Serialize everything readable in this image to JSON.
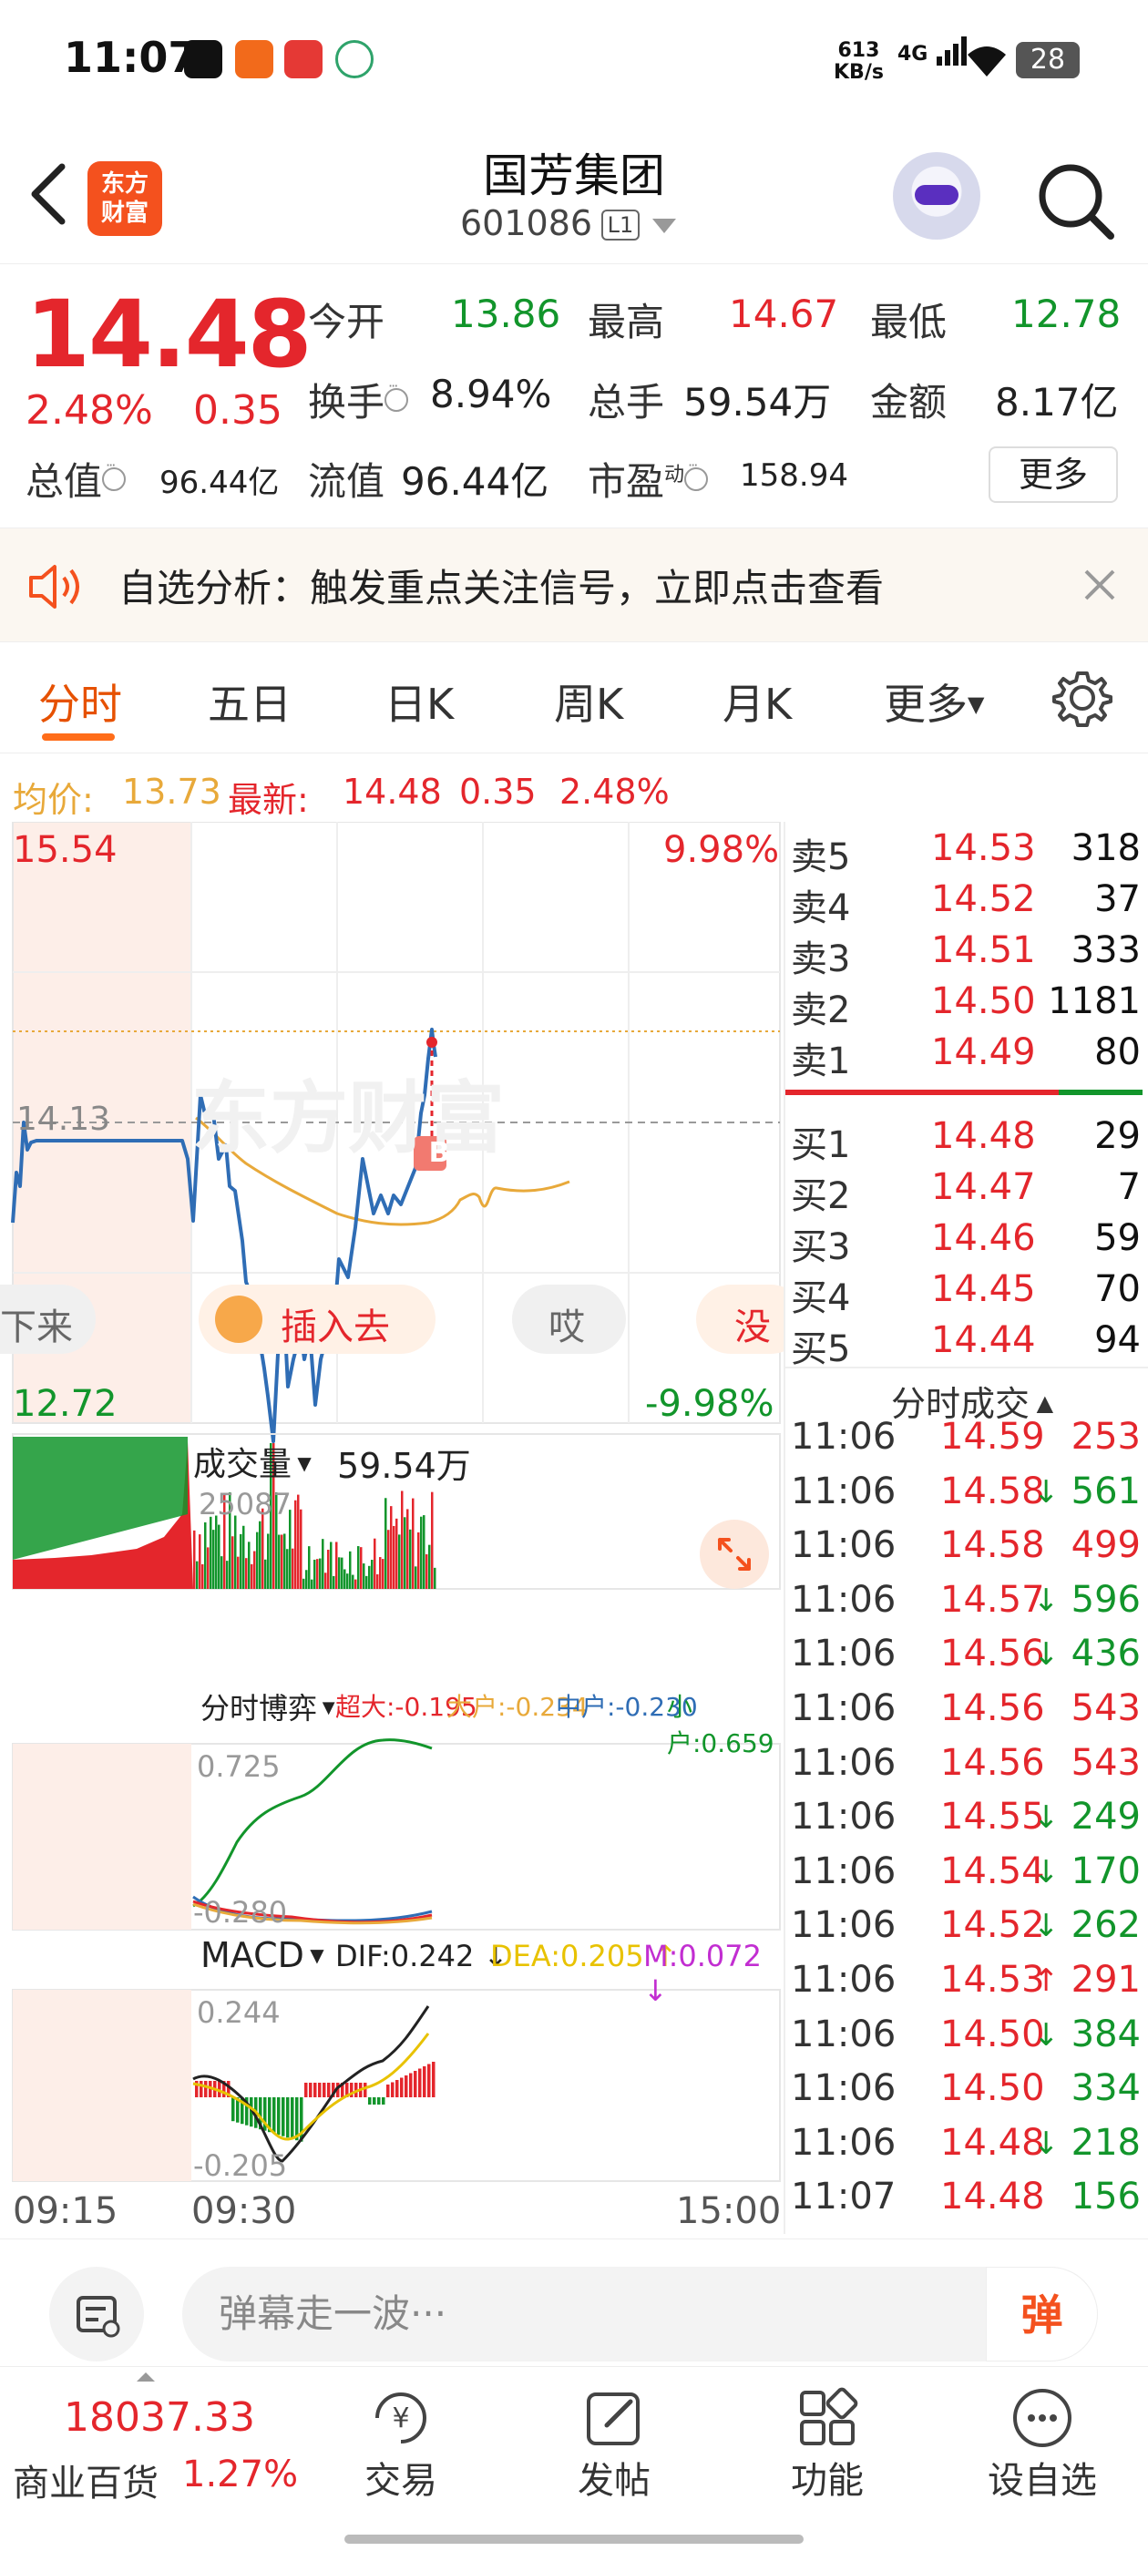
{
  "status_bar": {
    "time": "11:07",
    "rate_value": "613",
    "rate_unit": "KB/s",
    "network": "4G",
    "battery": "28"
  },
  "header": {
    "logo_line1": "东方",
    "logo_line2": "财富",
    "title": "国芳集团",
    "code": "601086",
    "level": "L1"
  },
  "quote": {
    "price": "14.48",
    "change_pct": "2.48%",
    "change": "0.35",
    "open_label": "今开",
    "open": "13.86",
    "high_label": "最高",
    "high": "14.67",
    "low_label": "最低",
    "low": "12.78",
    "turnover_label": "换手",
    "turnover": "8.94%",
    "volume_label": "总手",
    "volume": "59.54万",
    "amount_label": "金额",
    "amount": "8.17亿",
    "total_cap_label": "总值",
    "total_cap": "96.44亿",
    "float_cap_label": "流值",
    "float_cap": "96.44亿",
    "pe_label": "市盈",
    "pe_sup": "动",
    "pe": "158.94",
    "more_label": "更多"
  },
  "alert": {
    "text": "自选分析：触发重点关注信号，立即点击查看"
  },
  "tabs": [
    "分时",
    "五日",
    "日K",
    "周K",
    "月K",
    "更多"
  ],
  "avg_bar": {
    "avg_label": "均价:",
    "avg": "13.73",
    "latest_label": "最新:",
    "latest": "14.48",
    "chg": "0.35",
    "pct": "2.48%"
  },
  "chart": {
    "price_max": "15.54",
    "price_min": "12.72",
    "prev_close": "14.13",
    "pct_max": "9.98%",
    "pct_min": "-9.98%",
    "watermark": "东方财富",
    "buy_mark": "B",
    "danmu": [
      "下来",
      "插入去",
      "哎",
      "没"
    ],
    "volume_label": "成交量",
    "volume_total": "59.54万",
    "volume_max": "25087",
    "game_label": "分时博弈",
    "game_super": "超大:-0.195",
    "game_big": "大户:-0.234",
    "game_mid": "中户:-0.230",
    "game_small": "小户:0.659",
    "game_max": "0.725",
    "game_min": "-0.280",
    "macd_label": "MACD",
    "dif": "DIF:0.242",
    "dea": "DEA:0.205",
    "m": "M:0.072",
    "macd_max": "0.244",
    "macd_min": "-0.205",
    "time_start": "09:15",
    "time_open": "09:30",
    "time_end": "15:00",
    "colors": {
      "up": "#e4262c",
      "down": "#12952b",
      "price_line": "#2f6db5",
      "avg_line": "#e8a93a"
    }
  },
  "order_book": {
    "asks": [
      {
        "name": "卖5",
        "price": "14.53",
        "vol": "318"
      },
      {
        "name": "卖4",
        "price": "14.52",
        "vol": "37"
      },
      {
        "name": "卖3",
        "price": "14.51",
        "vol": "333"
      },
      {
        "name": "卖2",
        "price": "14.50",
        "vol": "1181"
      },
      {
        "name": "卖1",
        "price": "14.49",
        "vol": "80"
      }
    ],
    "bids": [
      {
        "name": "买1",
        "price": "14.48",
        "vol": "29"
      },
      {
        "name": "买2",
        "price": "14.47",
        "vol": "7"
      },
      {
        "name": "买3",
        "price": "14.46",
        "vol": "59"
      },
      {
        "name": "买4",
        "price": "14.45",
        "vol": "70"
      },
      {
        "name": "买5",
        "price": "14.44",
        "vol": "94"
      }
    ],
    "trades_title": "分时成交",
    "trades": [
      {
        "time": "11:06",
        "price": "14.59",
        "arrow": "",
        "vol": "253",
        "dir": "up"
      },
      {
        "time": "11:06",
        "price": "14.58",
        "arrow": "↓",
        "vol": "561",
        "dir": "down"
      },
      {
        "time": "11:06",
        "price": "14.58",
        "arrow": "",
        "vol": "499",
        "dir": "up"
      },
      {
        "time": "11:06",
        "price": "14.57",
        "arrow": "↓",
        "vol": "596",
        "dir": "down"
      },
      {
        "time": "11:06",
        "price": "14.56",
        "arrow": "↓",
        "vol": "436",
        "dir": "down"
      },
      {
        "time": "11:06",
        "price": "14.56",
        "arrow": "",
        "vol": "543",
        "dir": "up"
      },
      {
        "time": "11:06",
        "price": "14.56",
        "arrow": "",
        "vol": "543",
        "dir": "up"
      },
      {
        "time": "11:06",
        "price": "14.55",
        "arrow": "↓",
        "vol": "249",
        "dir": "down"
      },
      {
        "time": "11:06",
        "price": "14.54",
        "arrow": "↓",
        "vol": "170",
        "dir": "down"
      },
      {
        "time": "11:06",
        "price": "14.52",
        "arrow": "↓",
        "vol": "262",
        "dir": "down"
      },
      {
        "time": "11:06",
        "price": "14.53",
        "arrow": "↑",
        "vol": "291",
        "dir": "up"
      },
      {
        "time": "11:06",
        "price": "14.50",
        "arrow": "↓",
        "vol": "384",
        "dir": "down"
      },
      {
        "time": "11:06",
        "price": "14.50",
        "arrow": "",
        "vol": "334",
        "dir": "down"
      },
      {
        "time": "11:06",
        "price": "14.48",
        "arrow": "↓",
        "vol": "218",
        "dir": "down"
      },
      {
        "time": "11:07",
        "price": "14.48",
        "arrow": "",
        "vol": "156",
        "dir": "down"
      }
    ]
  },
  "input_bar": {
    "placeholder": "弹幕走一波···",
    "danmu_button": "弹"
  },
  "tab_bar": {
    "index_value": "18037.33",
    "index_name": "商业百货",
    "index_pct": "1.27%",
    "items": [
      {
        "label": "交易",
        "icon": "trade-icon"
      },
      {
        "label": "发帖",
        "icon": "post-icon"
      },
      {
        "label": "功能",
        "icon": "apps-icon"
      },
      {
        "label": "设自选",
        "icon": "more-icon"
      }
    ]
  }
}
